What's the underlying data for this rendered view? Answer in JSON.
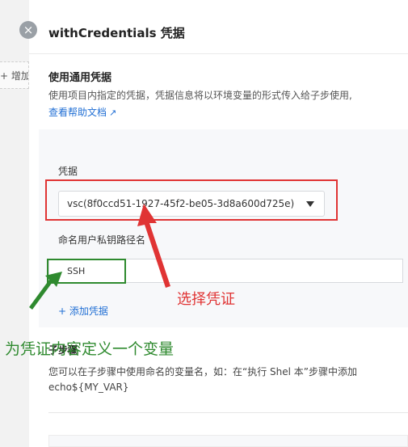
{
  "background_page": {
    "add_button_label": "+ 增加"
  },
  "drawer": {
    "close_glyph": "×",
    "title": "withCredentials 凭据",
    "section_title": "使用通用凭据",
    "section_desc": "使用项目内指定的凭据，凭据信息将以环境变量的形式传入给子步使用,",
    "help_link": "查看帮助文档",
    "credential_label": "凭据",
    "credential_value": "vsc(8f0ccd51-1927-45f2-be05-3d8a600d725e)",
    "name_label": "命名用户私钥路径名",
    "name_value": "SSH",
    "add_credential": "+ 添加凭据",
    "variable_title": "子步骤",
    "variable_desc": "您可以在子步骤中使用命名的变量名，如：在“执行 Shel 本”步骤中添加 echo${MY_VAR}"
  },
  "annotations": {
    "red_text": "选择凭证",
    "green_text": "为凭证内容定义一个变量",
    "red_color": "#e03434",
    "green_color": "#2f8a2f"
  },
  "colors": {
    "link": "#1f6ed4",
    "panel_bg": "#f7f8fa"
  }
}
